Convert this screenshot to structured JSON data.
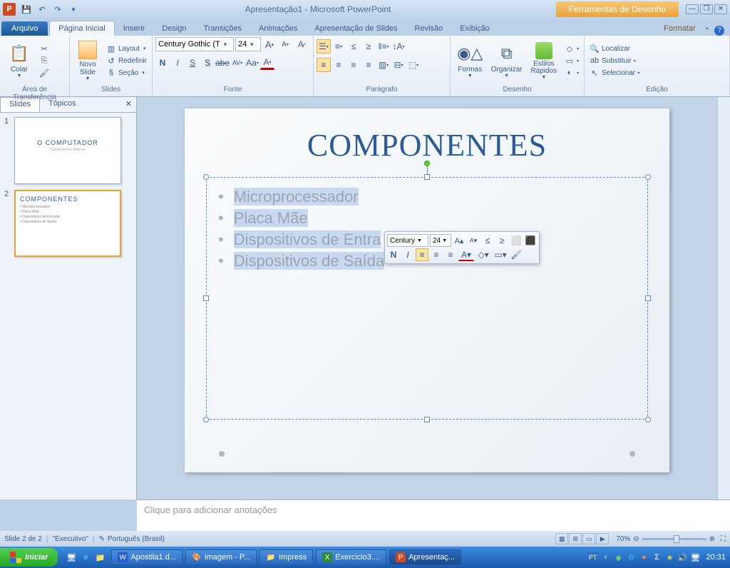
{
  "title": "Apresentação1 - Microsoft PowerPoint",
  "context_tab": "Ferramentas de Desenho",
  "tabs": {
    "file": "Arquivo",
    "home": "Página Inicial",
    "insert": "Inserir",
    "design": "Design",
    "transitions": "Transições",
    "animations": "Animações",
    "slideshow": "Apresentação de Slides",
    "review": "Revisão",
    "view": "Exibição",
    "format": "Formatar"
  },
  "ribbon": {
    "clipboard": {
      "title": "Área de Transferência",
      "paste": "Colar"
    },
    "slides": {
      "title": "Slides",
      "new_slide": "Novo Slide",
      "layout": "Layout",
      "reset": "Redefinir",
      "section": "Seção"
    },
    "font": {
      "title": "Fonte",
      "family": "Century Gothic (T",
      "size": "24"
    },
    "paragraph": {
      "title": "Parágrafo"
    },
    "drawing": {
      "title": "Desenho",
      "shapes": "Formas",
      "arrange": "Organizar",
      "quick": "Estilos Rápidos"
    },
    "editing": {
      "title": "Edição",
      "find": "Localizar",
      "replace": "Substituir",
      "select": "Selecionar"
    }
  },
  "panel": {
    "slides_tab": "Slides",
    "outline_tab": "Tópicos"
  },
  "thumbs": {
    "slide1": {
      "num": "1",
      "title": "O COMPUTADOR",
      "sub": "Componentes Básicos"
    },
    "slide2": {
      "num": "2",
      "title": "COMPONENTES",
      "l1": "• Microprocessador",
      "l2": "• Placa Mãe",
      "l3": "• Dispositivos de Entrada",
      "l4": "• Dispositivos de Saída"
    }
  },
  "slide": {
    "title": "COMPONENTES",
    "bullets": {
      "b1": "Microprocessador",
      "b2": "Placa Mãe",
      "b3": "Dispositivos de Entra",
      "b4": "Dispositivos de Saída"
    }
  },
  "mini_toolbar": {
    "font": "Century",
    "size": "24"
  },
  "notes_placeholder": "Clique para adicionar anotações",
  "status": {
    "slide": "Slide 2 de 2",
    "theme": "\"Executivo\"",
    "lang": "Português (Brasil)",
    "zoom": "70%"
  },
  "taskbar": {
    "start": "Iniciar",
    "apps": {
      "a1": "Apostila1.d...",
      "a2": "imagem - P...",
      "a3": "Impress",
      "a4": "Exercicio3....",
      "a5": "Apresentaç..."
    },
    "lang": "PT",
    "clock": "20:31"
  }
}
